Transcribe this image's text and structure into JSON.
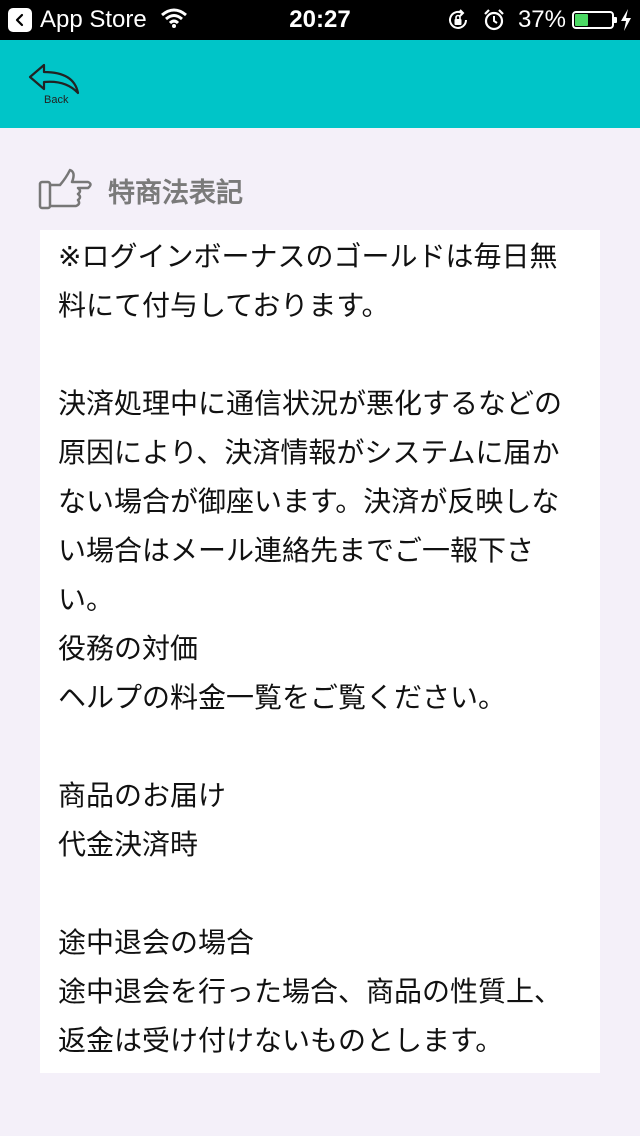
{
  "status_bar": {
    "back_app_label": "App Store",
    "time": "20:27",
    "battery_percent": "37%",
    "battery_level": 0.37
  },
  "nav": {
    "back_label": "Back"
  },
  "section": {
    "title": "特商法表記"
  },
  "content": {
    "text": "※ログインボーナスのゴールドは毎日無料にて付与しております。\n\n決済処理中に通信状況が悪化するなどの原因により、決済情報がシステムに届かない場合が御座います。決済が反映しない場合はメール連絡先までご一報下さい。\n役務の対価\nヘルプの料金一覧をご覧ください。\n\n商品のお届け\n代金決済時\n\n途中退会の場合\n途中退会を行った場合、商品の性質上、返金は受け付けないものとします。"
  }
}
